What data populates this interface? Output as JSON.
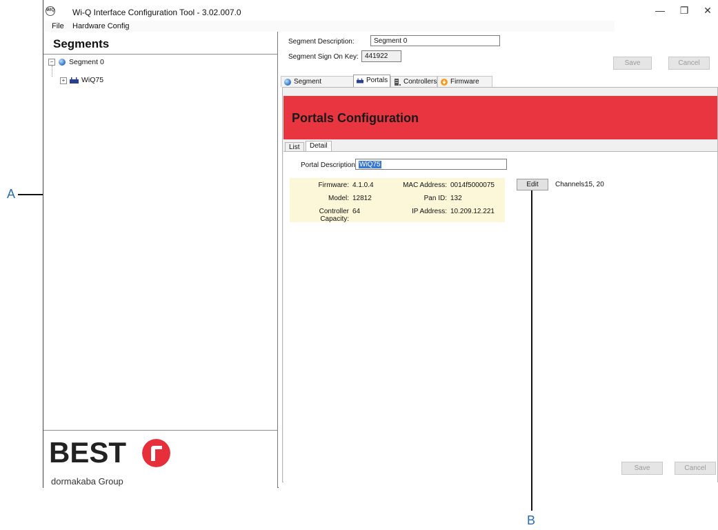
{
  "window": {
    "title": "Wi-Q Interface Configuration Tool - 3.02.007.0",
    "app_icon_text": "WIQ",
    "controls": {
      "minimize": "—",
      "restore": "❐",
      "close": "✕"
    }
  },
  "menu": {
    "items": [
      "File",
      "Hardware Config"
    ]
  },
  "left_pane": {
    "heading": "Segments",
    "tree": [
      {
        "label": "Segment 0",
        "expander": "−"
      },
      {
        "label": "WiQ75",
        "expander": "+"
      }
    ],
    "logo": {
      "brand": "BEST",
      "group": "dormakaba Group"
    }
  },
  "segment": {
    "description_label": "Segment Description:",
    "description_value": "Segment 0",
    "sign_on_key_label": "Segment Sign On Key:",
    "sign_on_key_value": "441922",
    "save_label": "Save",
    "cancel_label": "Cancel"
  },
  "tabs": [
    {
      "label": "Segment Credentials",
      "icon": "globe-icon"
    },
    {
      "label": "Portals",
      "icon": "portal-icon"
    },
    {
      "label": "Controllers",
      "icon": "controller-icon"
    },
    {
      "label": "Firmware Files",
      "icon": "firmware-icon"
    }
  ],
  "portals": {
    "banner_title": "Portals Configuration",
    "subtabs": [
      "List",
      "Detail"
    ],
    "portal_description_label": "Portal Description:",
    "portal_description_value": "WiQ75",
    "info": {
      "firmware_label": "Firmware:",
      "firmware_value": "4.1.0.4",
      "model_label": "Model:",
      "model_value": "12812",
      "capacity_label": "Controller Capacity:",
      "capacity_value": "64",
      "mac_label": "MAC Address:",
      "mac_value": "0014f5000075",
      "pan_label": "Pan ID:",
      "pan_value": "132",
      "ip_label": "IP Address:",
      "ip_value": "10.209.12.221"
    },
    "edit_label": "Edit",
    "channels_label": "Channels:",
    "channels_value": "15, 20",
    "save_label": "Save",
    "cancel_label": "Cancel"
  },
  "callouts": {
    "a": "A",
    "b": "B"
  },
  "colors": {
    "banner": "#e9353f",
    "info_box": "#fbf7d8",
    "logo_red": "#e62f3b",
    "callout": "#2d6ba8"
  }
}
